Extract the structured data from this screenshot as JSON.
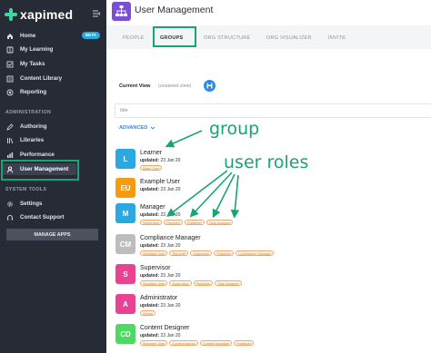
{
  "sidebar": {
    "brand": "xapimed",
    "nav_top": [
      {
        "label": "Home",
        "icon": "home-icon",
        "badge": "BETA"
      },
      {
        "label": "My Learning",
        "icon": "book-icon"
      },
      {
        "label": "My Tasks",
        "icon": "check-square-icon"
      },
      {
        "label": "Content Library",
        "icon": "list-icon"
      },
      {
        "label": "Reporting",
        "icon": "target-icon"
      }
    ],
    "admin_label": "ADMINISTRATION",
    "nav_admin": [
      {
        "label": "Authoring",
        "icon": "pencil-icon"
      },
      {
        "label": "Libraries",
        "icon": "library-icon"
      },
      {
        "label": "Performance",
        "icon": "chart-icon"
      },
      {
        "label": "User Management",
        "icon": "user-icon"
      }
    ],
    "tools_label": "SYSTEM TOOLS",
    "nav_tools": [
      {
        "label": "Settings",
        "icon": "gear-icon"
      },
      {
        "label": "Contact Support",
        "icon": "headset-icon"
      }
    ],
    "manage_apps": "MANAGE APPS"
  },
  "header": {
    "title": "User Management",
    "icon": "org-chart-icon"
  },
  "tabs": [
    "PEOPLE",
    "GROUPS",
    "ORG STRUCTURE",
    "ORG VISUALIZER",
    "INVITE"
  ],
  "active_tab": "GROUPS",
  "view": {
    "label": "Current View",
    "status": "(unsaved view)"
  },
  "search": {
    "placeholder": "title"
  },
  "advanced": "ADVANCED",
  "annotations": {
    "group": "group",
    "user_roles": "user roles"
  },
  "groups": [
    {
      "initials": "L",
      "name": "Learner",
      "updated_label": "updated:",
      "updated": "23 Jan 20",
      "color": "#2aa8e0",
      "roles": [
        "Basic User"
      ]
    },
    {
      "initials": "EU",
      "name": "Example User",
      "updated_label": "updated:",
      "updated": "23 Jan 20",
      "color": "#f39c12",
      "roles": []
    },
    {
      "initials": "M",
      "name": "Manager",
      "updated_label": "updated:",
      "updated": "23 Jan 20",
      "color": "#2aa8e0",
      "roles": [
        "Supervisor",
        "Reporter",
        "Publisher",
        "Task Assigner"
      ]
    },
    {
      "initials": "CM",
      "name": "Compliance Manager",
      "updated_label": "updated:",
      "updated": "23 Jan 20",
      "color": "#bdbdbd",
      "roles": [
        "Standard User",
        "Reporter",
        "Supervisor",
        "Publisher",
        "Compliance Manager"
      ]
    },
    {
      "initials": "S",
      "name": "Supervisor",
      "updated_label": "updated:",
      "updated": "23 Jan 20",
      "color": "#e84393",
      "roles": [
        "Standard User",
        "Supervisor",
        "Publisher",
        "Task Assigner"
      ]
    },
    {
      "initials": "A",
      "name": "Administrator",
      "updated_label": "updated:",
      "updated": "23 Jan 20",
      "color": "#e84393",
      "roles": [
        "Owner"
      ]
    },
    {
      "initials": "CD",
      "name": "Content Designer",
      "updated_label": "updated:",
      "updated": "23 Jan 20",
      "color": "#4cd964",
      "roles": [
        "Standard User",
        "Content Author",
        "Content Manager",
        "Publisher"
      ]
    }
  ],
  "colors": {
    "sidebar_bg": "#262b35",
    "accent_purple": "#7c4dd6",
    "annotation_green": "#17a673",
    "link_blue": "#2a8be0",
    "role_orange": "#e07b1f"
  }
}
